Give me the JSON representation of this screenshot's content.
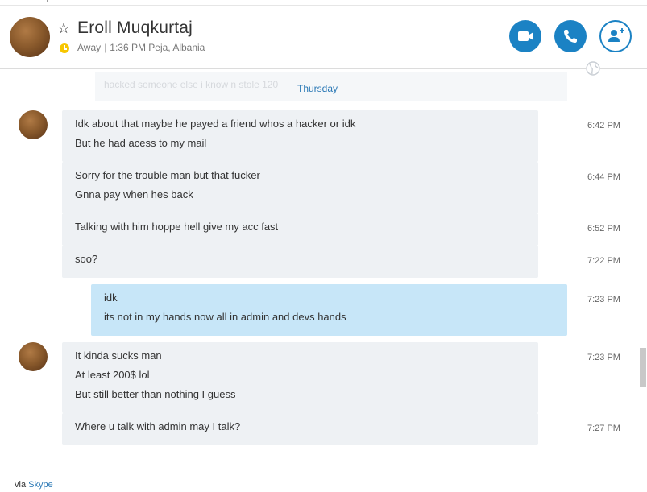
{
  "contact": {
    "name": "Eroll Muqkurtaj",
    "status": "Away",
    "local_time": "1:36 PM Peja, Albania"
  },
  "header_buttons": {
    "video_icon": "video-camera-icon",
    "call_icon": "phone-icon",
    "add_icon": "add-person-icon"
  },
  "chat": {
    "faded_preview": "hacked someone else i know n stole 120",
    "day_divider": "Thursday",
    "messages": [
      {
        "direction": "in",
        "lines": [
          "Idk about that maybe he payed a friend whos a hacker or idk",
          "But he had acess to my mail"
        ],
        "time": "6:42 PM"
      },
      {
        "direction": "in",
        "lines": [
          "Sorry for the trouble man but that fucker",
          "Gnna pay when hes back"
        ],
        "time": "6:44 PM"
      },
      {
        "direction": "in",
        "lines": [
          "Talking with him hoppe hell give my acc fast"
        ],
        "time": "6:52 PM"
      },
      {
        "direction": "in",
        "lines": [
          "soo?"
        ],
        "time": "7:22 PM"
      },
      {
        "direction": "out",
        "lines": [
          "idk",
          "its not in my hands now all in admin and devs hands"
        ],
        "time": "7:23 PM"
      },
      {
        "direction": "in",
        "lines": [
          "It kinda sucks man",
          "At least 200$ lol",
          "But still better than nothing I guess"
        ],
        "time": "7:23 PM"
      },
      {
        "direction": "in",
        "lines": [
          "Where u talk with admin may I talk?"
        ],
        "time": "7:27 PM"
      }
    ]
  },
  "footer": {
    "prefix": "via",
    "link": "Skype"
  },
  "colors": {
    "accent": "#1b82c4",
    "incoming_bubble": "#eef1f4",
    "outgoing_bubble": "#c7e6f8",
    "away_status": "#f7c600"
  }
}
